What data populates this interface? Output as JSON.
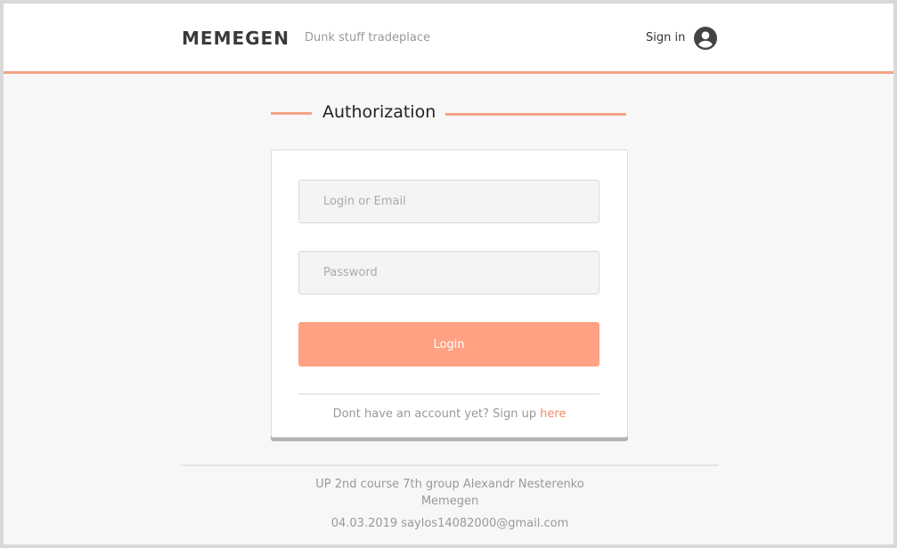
{
  "header": {
    "brand": "MEMEGEN",
    "tagline": "Dunk stuff tradeplace",
    "signin_label": "Sign in",
    "user_icon": "account-circle-icon"
  },
  "auth": {
    "title": "Authorization",
    "login_placeholder": "Login or Email",
    "login_value": "",
    "password_placeholder": "Password",
    "password_value": "",
    "login_button": "Login",
    "signup_text": "Dont have an account yet? Sign up",
    "signup_link": "here"
  },
  "footer": {
    "line1": "UP 2nd course 7th group Alexandr Nesterenko",
    "line2": "Memegen",
    "line3": "04.03.2019 saylos14082000@gmail.com"
  },
  "colors": {
    "accent": "#f2a385",
    "button": "#ffa182",
    "link": "#f08a6a"
  }
}
